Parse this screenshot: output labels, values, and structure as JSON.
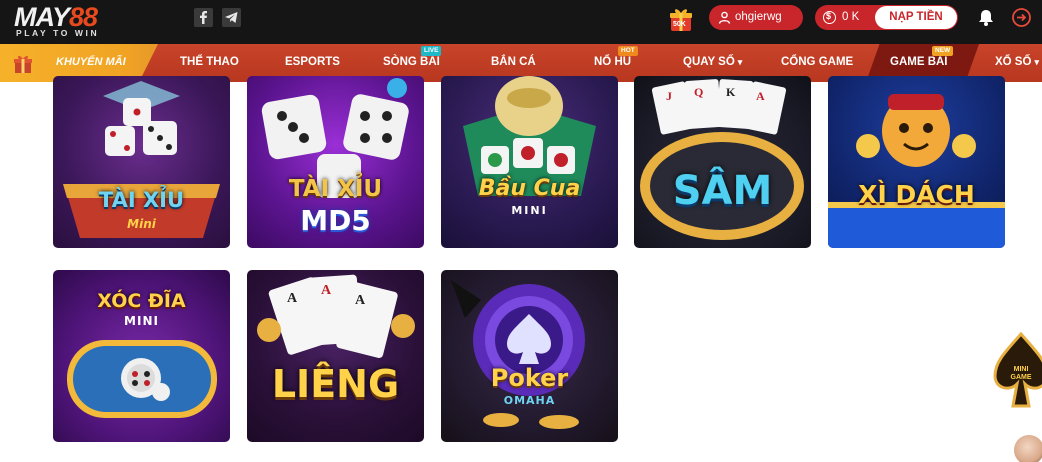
{
  "brand": {
    "name_part1": "MAY",
    "name_part2": "88",
    "tagline": "PLAY TO WIN"
  },
  "header": {
    "gift_badge": "50K",
    "username": "ohgierwg",
    "balance": "0 K",
    "deposit_label": "NẠP TIỀN"
  },
  "nav": {
    "promo_label": "KHUYẾN MÃI",
    "items": [
      {
        "label": "THỂ THAO",
        "badge": ""
      },
      {
        "label": "ESPORTS",
        "badge": ""
      },
      {
        "label": "SÒNG BÀI",
        "badge": "LIVE"
      },
      {
        "label": "BẮN CÁ",
        "badge": ""
      },
      {
        "label": "NỔ HŨ",
        "badge": "HOT"
      },
      {
        "label": "QUAY SỐ",
        "badge": ""
      },
      {
        "label": "CỔNG GAME",
        "badge": ""
      },
      {
        "label": "GAME BÀI",
        "badge": "NEW"
      },
      {
        "label": "XỔ SỐ",
        "badge": ""
      }
    ]
  },
  "games": [
    {
      "title": "TÀI XỈU",
      "subtitle": "Mini"
    },
    {
      "title": "TÀI XỈU",
      "subtitle": "MD5"
    },
    {
      "title": "Bầu Cua",
      "subtitle": "MINI"
    },
    {
      "title": "SÂM",
      "subtitle": ""
    },
    {
      "title": "XÌ DÁCH",
      "subtitle": ""
    },
    {
      "title": "XÓC ĐĨA",
      "subtitle": "MINI"
    },
    {
      "title": "LIÊNG",
      "subtitle": ""
    },
    {
      "title": "Poker",
      "subtitle": "OMAHA"
    }
  ],
  "floating": {
    "mini_game_label": "MINI GAME"
  },
  "colors": {
    "topbar": "#151515",
    "navbar": "#c8442a",
    "accent": "#c9262b",
    "promo": "#f0a323"
  }
}
